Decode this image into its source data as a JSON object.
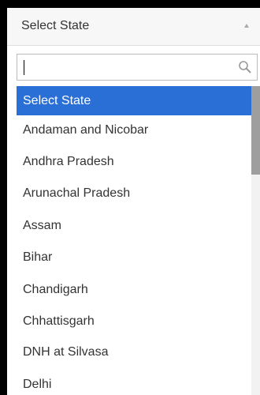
{
  "select": {
    "label": "Select State",
    "arrow_icon": "chevron-up-icon"
  },
  "search": {
    "value": "",
    "placeholder": "",
    "icon": "search-icon"
  },
  "options": [
    {
      "label": "Select State",
      "selected": true
    },
    {
      "label": "Andaman and Nicobar",
      "selected": false
    },
    {
      "label": "Andhra Pradesh",
      "selected": false
    },
    {
      "label": "Arunachal Pradesh",
      "selected": false
    },
    {
      "label": "Assam",
      "selected": false
    },
    {
      "label": "Bihar",
      "selected": false
    },
    {
      "label": "Chandigarh",
      "selected": false
    },
    {
      "label": "Chhattisgarh",
      "selected": false
    },
    {
      "label": "DNH at Silvasa",
      "selected": false
    },
    {
      "label": "Delhi",
      "selected": false
    }
  ],
  "colors": {
    "selected_bg": "#2a6fd6",
    "selected_text": "#ffffff",
    "frame": "#000000"
  }
}
